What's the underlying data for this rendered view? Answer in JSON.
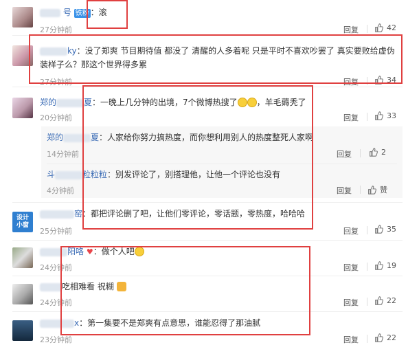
{
  "comments": [
    {
      "name_suffix": "号",
      "badge": "铁粉",
      "text": "：滚",
      "time": "27分钟前",
      "reply": "回复",
      "likes": "42"
    },
    {
      "name_suffix": "ky",
      "text_line1": "：没了郑爽 节目期待值 都没了 清醒的人多着呢 只是平时不喜欢吵罢了 真实要败给虚伪",
      "text_line2": "装样子么？那这个世界得多累",
      "time": "27分钟前",
      "reply": "回复",
      "likes": "34"
    },
    {
      "name_prefix": "郑的",
      "name_suffix": "夏",
      "text_a": "：一晚上几分钟的出境，7个微博热搜了",
      "text_b": "，羊毛薅秃了",
      "time": "20分钟前",
      "reply": "回复",
      "likes": "33"
    },
    {
      "name_prefix": "郑的",
      "name_suffix": "夏",
      "text": "：人家给你努力搞热度，而你想利用别人的热度整死人家啊",
      "time": "14分钟前",
      "reply": "回复",
      "likes": "2"
    },
    {
      "name_prefix": "斗",
      "name_suffix": "粒粒粒",
      "text": "：别发评论了，别搭理他，让他一个评论也没有",
      "time": "4分钟前",
      "reply": "回复",
      "likes": "赞"
    },
    {
      "name_suffix": "窑",
      "avatar_text": "设计小窗",
      "text": "：都把评论删了吧，让他们零评论，零话题，零热度，哈哈哈",
      "time": "25分钟前",
      "reply": "回复",
      "likes": "35"
    },
    {
      "name_suffix": "阳咯",
      "text": "：做个人吧",
      "time": "24分钟前",
      "reply": "回复",
      "likes": "19"
    },
    {
      "name_suffix": "",
      "text": "吃相难看 祝糊",
      "time": "24分钟前",
      "reply": "回复",
      "likes": "22"
    },
    {
      "name_suffix": "x",
      "text": "：第一集要不是郑爽有点意思，谁能忍得了那油腻",
      "time": "23分钟前",
      "reply": "回复",
      "likes": "22"
    }
  ],
  "colors": {
    "name": "#3a6bb5",
    "highlight": "#e04040",
    "subbg": "#f7f7f7"
  }
}
